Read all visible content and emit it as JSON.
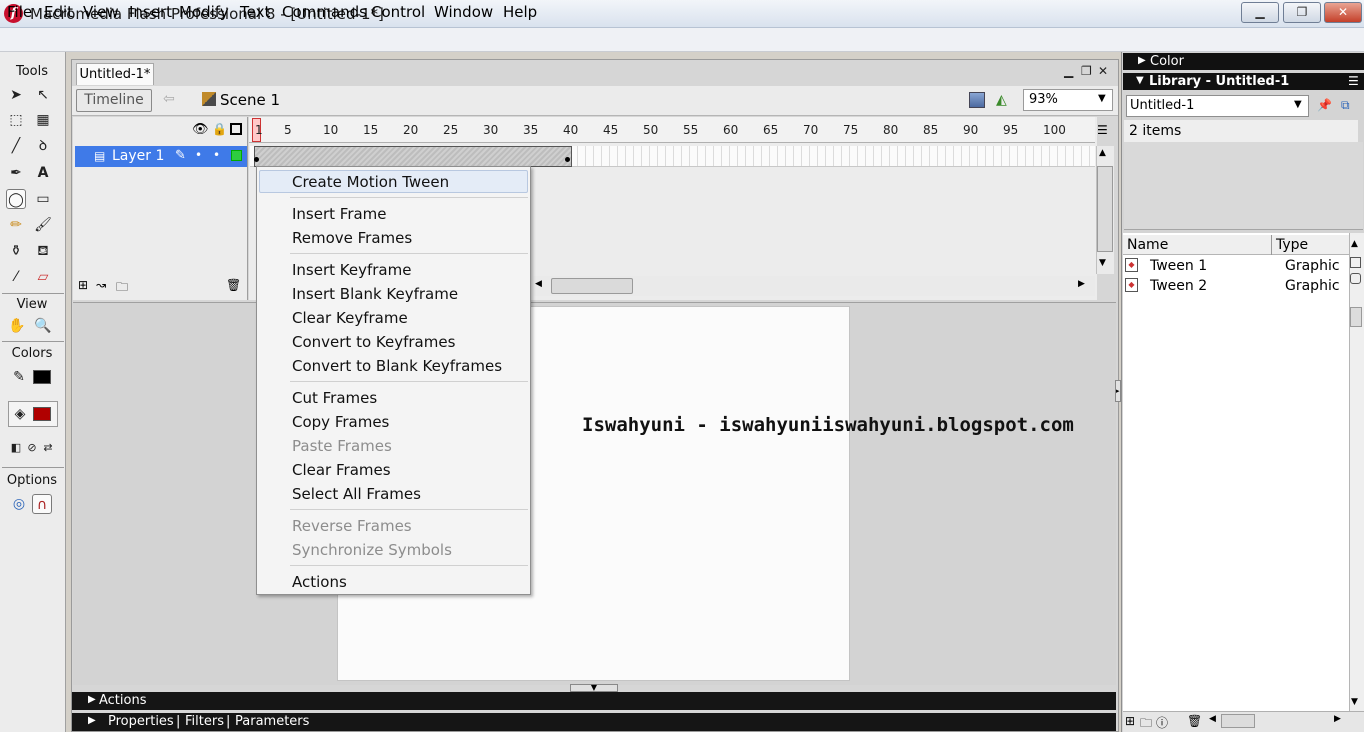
{
  "window": {
    "title": "Macromedia Flash Professional 8 - [Untitled-1*]"
  },
  "menubar": [
    "File",
    "Edit",
    "View",
    "Insert",
    "Modify",
    "Text",
    "Commands",
    "Control",
    "Window",
    "Help"
  ],
  "tools": {
    "header": "Tools",
    "view_header": "View",
    "colors_header": "Colors",
    "options_header": "Options"
  },
  "document": {
    "tab": "Untitled-1*",
    "timeline_button": "Timeline",
    "scene": "Scene 1",
    "zoom": "93%"
  },
  "timeline": {
    "ruler_ticks": [
      "1",
      "5",
      "10",
      "15",
      "20",
      "25",
      "30",
      "35",
      "40",
      "45",
      "50",
      "55",
      "60",
      "65",
      "70",
      "75",
      "80",
      "85",
      "90",
      "95",
      "100"
    ],
    "layer_name": "Layer 1"
  },
  "stage": {
    "text": "Iswahyuni - iswahyuniiswahyuni.blogspot.com"
  },
  "context_menu": {
    "items": [
      "Create Motion Tween",
      "Insert Frame",
      "Remove Frames",
      "Insert Keyframe",
      "Insert Blank Keyframe",
      "Clear Keyframe",
      "Convert to Keyframes",
      "Convert to Blank Keyframes",
      "Cut Frames",
      "Copy Frames",
      "Paste Frames",
      "Clear Frames",
      "Select All Frames",
      "Reverse Frames",
      "Synchronize Symbols",
      "Actions"
    ],
    "disabled": [
      "Paste Frames",
      "Reverse Frames",
      "Synchronize Symbols"
    ]
  },
  "bottom_panels": {
    "actions": "Actions",
    "properties": "Properties",
    "filters": "Filters",
    "parameters": "Parameters"
  },
  "right_panel": {
    "color_label": "Color",
    "library_label": "Library - Untitled-1",
    "library_select": "Untitled-1",
    "item_count": "2 items",
    "columns": [
      "Name",
      "Type"
    ],
    "items": [
      {
        "name": "Tween 1",
        "type": "Graphic"
      },
      {
        "name": "Tween 2",
        "type": "Graphic"
      }
    ]
  },
  "colors": {
    "layer_highlight": "#3f7ae8",
    "close_button": "#c4402a",
    "app_icon": "#c8102e"
  }
}
